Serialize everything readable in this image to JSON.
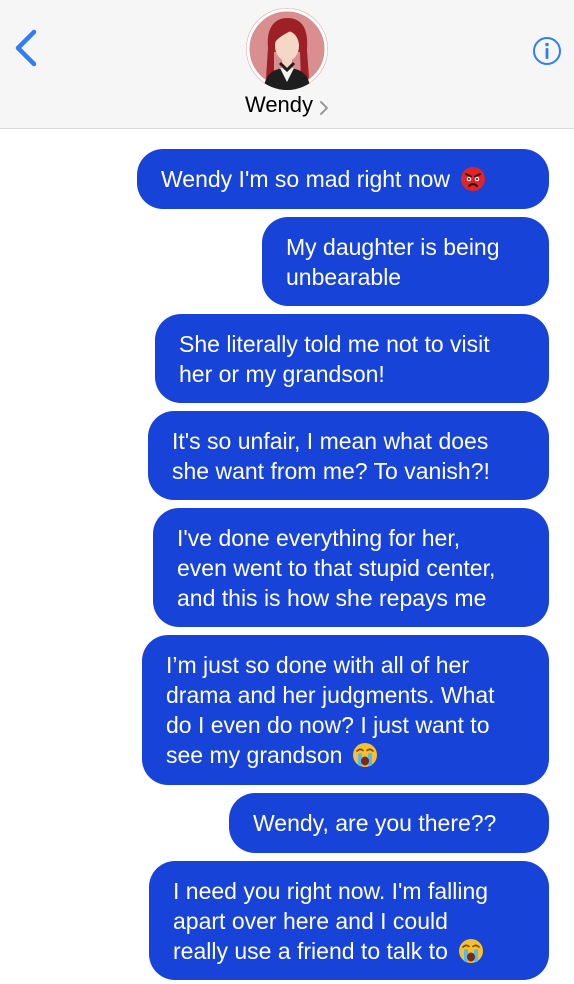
{
  "header": {
    "contact_name": "Wendy",
    "back_icon": "chevron-left-icon",
    "info_icon": "info-icon",
    "avatar_icon": "avatar"
  },
  "colors": {
    "header_bg": "#f6f6f6",
    "accent_blue": "#2f7ef6",
    "bubble_blue": "#1743d8",
    "bubble_text": "#ffffff"
  },
  "messages": [
    {
      "lines": [
        "Wendy I'm so mad right now"
      ],
      "emoji": "angry-face-icon"
    },
    {
      "lines": [
        "My daughter is being",
        "unbearable"
      ]
    },
    {
      "lines": [
        "She literally told me not to visit",
        "her or my grandson!"
      ]
    },
    {
      "lines": [
        "It's so unfair, I mean what does",
        "she want from me? To vanish?!"
      ]
    },
    {
      "lines": [
        "I've done everything for her,",
        "even went to that stupid center,",
        "and this is how she repays me"
      ]
    },
    {
      "lines": [
        "I’m just so done with all of her",
        "drama and her judgments. What",
        "do I even do now? I just want to",
        "see my grandson"
      ],
      "emoji": "crying-face-icon"
    },
    {
      "lines": [
        "Wendy, are you there??"
      ]
    },
    {
      "lines": [
        "I need you right now. I'm falling",
        "apart over here and I could",
        "really use a friend to talk to"
      ],
      "emoji": "crying-face-icon"
    }
  ]
}
